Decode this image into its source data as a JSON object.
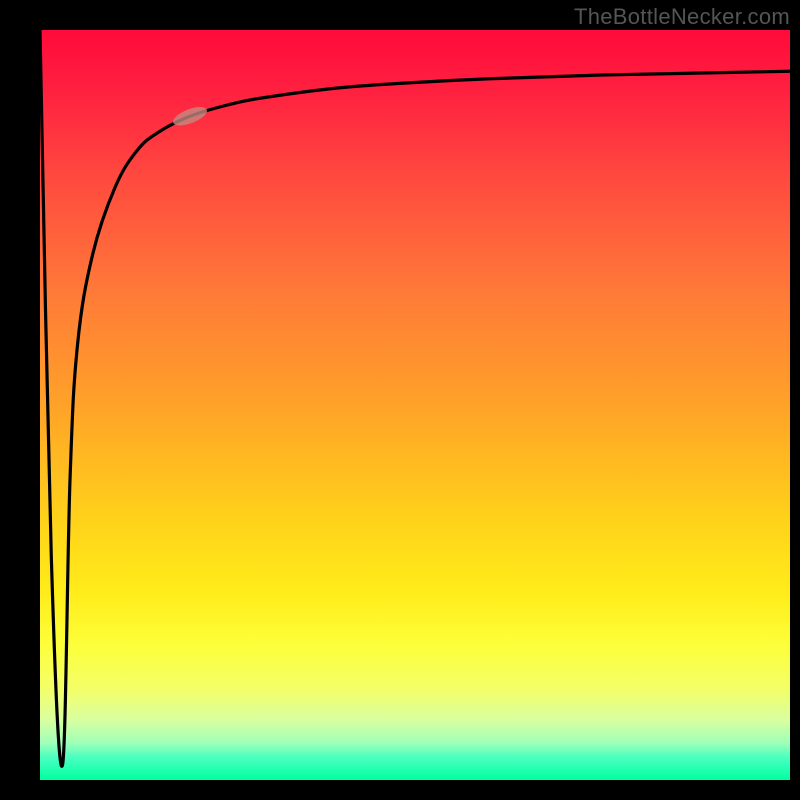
{
  "attribution": "TheBottleNecker.com",
  "colors": {
    "background": "#000000",
    "attribution_text": "#555555",
    "curve_stroke": "#000000",
    "marker_fill": "#c38c82"
  },
  "chart_data": {
    "type": "line",
    "title": "",
    "xlabel": "",
    "ylabel": "",
    "xlim": [
      0,
      100
    ],
    "ylim": [
      0,
      100
    ],
    "x": [
      0,
      1.5,
      3,
      4,
      5,
      7,
      10,
      13,
      16,
      20,
      25,
      30,
      40,
      50,
      60,
      75,
      90,
      100
    ],
    "values": [
      100,
      30,
      2,
      40,
      58,
      70,
      79,
      84,
      86.5,
      88.5,
      90,
      91,
      92.3,
      93,
      93.5,
      94,
      94.3,
      94.5
    ],
    "annotations": [
      {
        "type": "marker",
        "shape": "blob",
        "x": 20,
        "y": 88.5,
        "color": "#c38c82"
      }
    ],
    "gradient": [
      {
        "pos": 0,
        "color": "#ff0a3a"
      },
      {
        "pos": 20,
        "color": "#ff4a3f"
      },
      {
        "pos": 50,
        "color": "#ffa228"
      },
      {
        "pos": 75,
        "color": "#ffec1a"
      },
      {
        "pos": 92,
        "color": "#d8ffa0"
      },
      {
        "pos": 100,
        "color": "#00ffa0"
      }
    ]
  }
}
